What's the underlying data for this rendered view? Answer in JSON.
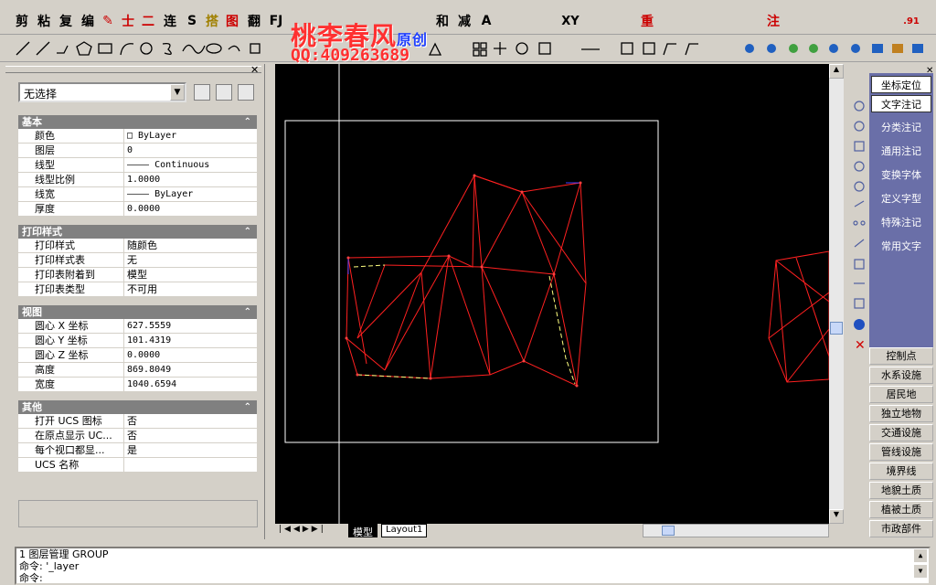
{
  "toolbar_top": {
    "items": [
      "剪",
      "粘",
      "复",
      "编",
      "✎",
      "士",
      "二",
      "连",
      "S",
      "搭",
      "图",
      "翻",
      "FJ",
      "和",
      "减",
      "A",
      "XY",
      "重",
      "注",
      ".91"
    ]
  },
  "watermark": {
    "line1": "桃李春风",
    "line1b": "原创",
    "line2": "QQ:409263689"
  },
  "properties": {
    "selection": "无选择",
    "sections": [
      {
        "title": "基本",
        "rows": [
          {
            "k": "颜色",
            "v": "□ ByLayer"
          },
          {
            "k": "图层",
            "v": "0"
          },
          {
            "k": "线型",
            "v": "———— Continuous"
          },
          {
            "k": "线型比例",
            "v": "1.0000"
          },
          {
            "k": "线宽",
            "v": "———— ByLayer"
          },
          {
            "k": "厚度",
            "v": "0.0000"
          }
        ]
      },
      {
        "title": "打印样式",
        "rows": [
          {
            "k": "打印样式",
            "v": "随颜色"
          },
          {
            "k": "打印样式表",
            "v": "无"
          },
          {
            "k": "打印表附着到",
            "v": "模型"
          },
          {
            "k": "打印表类型",
            "v": "不可用"
          }
        ]
      },
      {
        "title": "视图",
        "rows": [
          {
            "k": "圆心 X 坐标",
            "v": "627.5559"
          },
          {
            "k": "圆心 Y 坐标",
            "v": "101.4319"
          },
          {
            "k": "圆心 Z 坐标",
            "v": "0.0000"
          },
          {
            "k": "高度",
            "v": "869.8049"
          },
          {
            "k": "宽度",
            "v": "1040.6594"
          }
        ]
      },
      {
        "title": "其他",
        "rows": [
          {
            "k": "打开 UCS 图标",
            "v": "否"
          },
          {
            "k": "在原点显示 UC...",
            "v": "否"
          },
          {
            "k": "每个视口都显...",
            "v": "是"
          },
          {
            "k": "UCS 名称",
            "v": ""
          }
        ]
      }
    ]
  },
  "tabs": {
    "model": "模型",
    "layout": "Layout1"
  },
  "right_menu": {
    "items": [
      "坐标定位",
      "文字注记",
      "分类注记",
      "通用注记",
      "变换字体",
      "定义字型",
      "特殊注记",
      "常用文字"
    ],
    "categories": [
      "控制点",
      "水系设施",
      "居民地",
      "独立地物",
      "交通设施",
      "管线设施",
      "境界线",
      "地貌土质",
      "植被土质",
      "市政部件"
    ]
  },
  "command": {
    "line1": "1 图层管理 GROUP",
    "line2": "命令: '_layer",
    "line3": "命令:"
  },
  "colors": {
    "canvas": "#000000",
    "accent": "#6a6fa8",
    "tin_line": "#ff2020"
  }
}
